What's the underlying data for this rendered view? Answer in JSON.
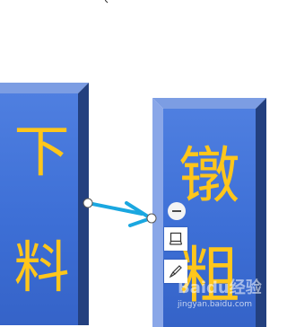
{
  "blocks": {
    "left": {
      "chars": [
        "下",
        "料"
      ]
    },
    "right": {
      "chars": [
        "镦",
        "粗"
      ]
    }
  },
  "colors": {
    "block_face": "#3d6fd6",
    "text": "#ffc61b",
    "arrow": "#1aa7e0"
  },
  "toolbar": {
    "minus_icon": "minus-circle-icon",
    "frame_icon": "frame-icon",
    "brush_icon": "brush-icon"
  },
  "watermark": {
    "logo": "Baidu经验",
    "url": "jingyan.baidu.com"
  }
}
